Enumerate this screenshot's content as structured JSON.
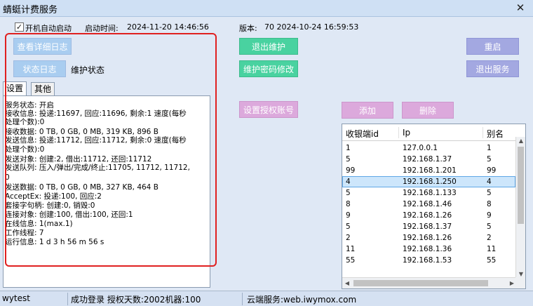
{
  "window": {
    "title": "蜻蜓计费服务",
    "close_glyph": "✕"
  },
  "header": {
    "autostart_checked": true,
    "autostart_label": "开机自动启动",
    "start_time_label": "启动时间:",
    "start_time_value": "2024-11-20 14:46:56",
    "version_label": "版本:",
    "version_value": "70  2024-10-24 16:59:53"
  },
  "buttons": {
    "view_log": "查看详细日志",
    "exit_maintenance": "退出维护",
    "restart": "重启",
    "status_log": "状态日志",
    "maintenance_state": "维护状态",
    "change_maintenance_password": "维护密码修改",
    "exit_service": "退出服务",
    "set_auth_account": "设置授权账号",
    "add": "添加",
    "delete": "删除"
  },
  "tabs": [
    {
      "label": "设置",
      "active": true
    },
    {
      "label": "其他",
      "active": false
    }
  ],
  "status_lines": [
    "服务状态: 开启",
    "接收信息: 投递:11697, 回应:11696, 剩余:1 速度(每秒",
    "处理个数):0",
    "接收数据: 0 TB, 0 GB, 0 MB, 319 KB, 896 B",
    "发送信息: 投递:11712, 回应:11712, 剩余:0 速度(每秒",
    "处理个数):0",
    "发送对象: 创建:2, 借出:11712, 还回:11712",
    "发送队列: 压入/弹出/完成/终止:11705, 11712, 11712,",
    "0",
    "发送数据: 0 TB, 0 GB, 0 MB, 327 KB, 464 B",
    "AcceptEx: 投递:100, 回应:2",
    "套接字句柄: 创建:0, 销毁:0",
    "连接对象: 创建:100, 借出:100, 还回:1",
    "在线信息: 1(max.1)",
    "工作线程: 7",
    "运行信息: 1 d 3 h 56 m 56 s"
  ],
  "table": {
    "columns": [
      "收银端id",
      "Ip",
      "别名"
    ],
    "rows": [
      [
        "1",
        "127.0.0.1",
        "1"
      ],
      [
        "5",
        "192.168.1.37",
        "5"
      ],
      [
        "99",
        "192.168.1.201",
        "99"
      ],
      [
        "4",
        "192.168.1.250",
        "4"
      ],
      [
        "5",
        "192.168.1.133",
        "5"
      ],
      [
        "8",
        "192.168.1.46",
        "8"
      ],
      [
        "9",
        "192.168.1.26",
        "9"
      ],
      [
        "5",
        "192.168.1.37",
        "5"
      ],
      [
        "2",
        "192.168.1.26",
        "2"
      ],
      [
        "11",
        "192.168.1.36",
        "11"
      ],
      [
        "55",
        "192.168.1.53",
        "55"
      ]
    ],
    "selected_row": 3
  },
  "statusbar": {
    "user": "wytest",
    "login_info": "成功登录 授权天数:2002机器:100",
    "cloud_service": "云端服务:web.iwymox.com"
  },
  "colors": {
    "highlight_box": "#e02020",
    "button_blue": "#a9cdf0",
    "button_green": "#49d2a0",
    "button_lavender": "#a3a8e1",
    "button_pink": "#dca9dc"
  }
}
